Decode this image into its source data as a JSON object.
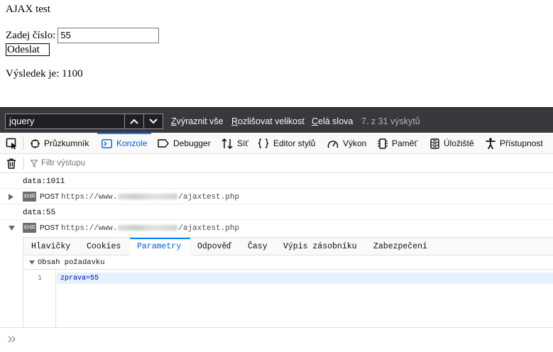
{
  "page": {
    "title": "AJAX test",
    "number_label": "Zadej číslo:",
    "number_value": "55",
    "send_label": "Odeslat",
    "result_label": "Výsledek je:",
    "result_value": "1100"
  },
  "findbar": {
    "query": "jquery",
    "highlight_all_prefix": "Z",
    "highlight_all_rest": "výraznit vše",
    "match_case_prefix": "R",
    "match_case_rest": "ozlišovat velikost",
    "whole_words_prefix": "C",
    "whole_words_rest": "elá slova",
    "match_count": "7. z 31 výskytů"
  },
  "devtools": {
    "tabs": [
      {
        "label": "Průzkumník",
        "icon": "inspector-icon"
      },
      {
        "label": "Konzole",
        "icon": "console-icon",
        "active": true
      },
      {
        "label": "Debugger",
        "icon": "debugger-icon"
      },
      {
        "label": "Síť",
        "icon": "network-icon"
      },
      {
        "label": "Editor stylů",
        "icon": "style-editor-icon"
      },
      {
        "label": "Výkon",
        "icon": "performance-icon"
      },
      {
        "label": "Paměť",
        "icon": "memory-icon"
      },
      {
        "label": "Úložiště",
        "icon": "storage-icon"
      },
      {
        "label": "Přístupnost",
        "icon": "accessibility-icon"
      }
    ],
    "accent_color": "#0a84ff"
  },
  "console": {
    "filter_placeholder": "Filtr výstupu",
    "messages": [
      {
        "type": "log",
        "text": "data:1011"
      },
      {
        "type": "xhr",
        "badge": "XHR",
        "method": "POST",
        "url_prefix": "https://www.",
        "url_suffix": "/ajaxtest.php",
        "expanded": false
      },
      {
        "type": "log",
        "text": "data:55"
      },
      {
        "type": "xhr",
        "badge": "XHR",
        "method": "POST",
        "url_prefix": "https://www.",
        "url_suffix": "/ajaxtest.php",
        "expanded": true
      }
    ],
    "details": {
      "tabs": [
        "Hlavičky",
        "Cookies",
        "Parametry",
        "Odpověď",
        "Časy",
        "Výpis zásobníku",
        "Zabezpečení"
      ],
      "active_tab": "Parametry",
      "section_label": "Obsah požadavku",
      "line_number": "1",
      "code": "zprava=55"
    }
  }
}
